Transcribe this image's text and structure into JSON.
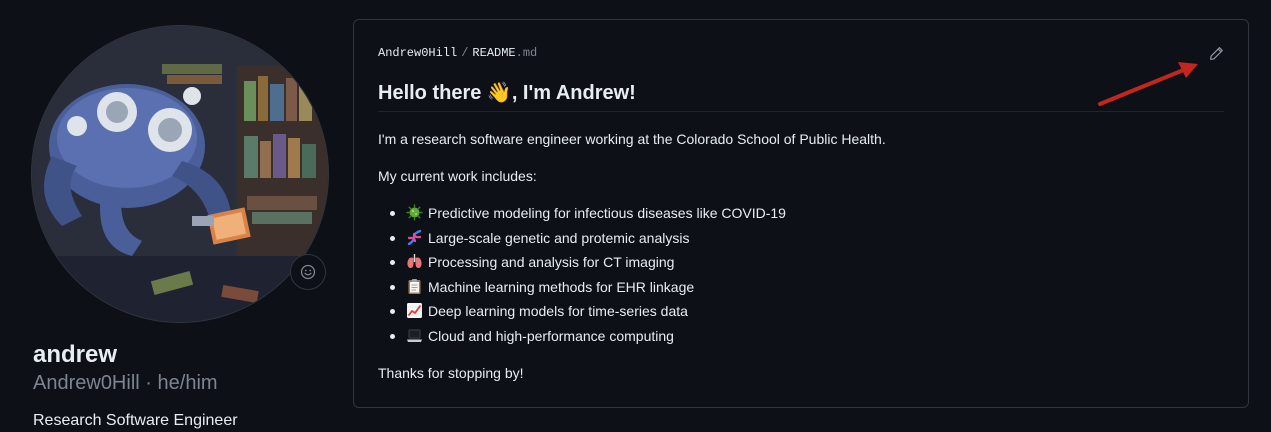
{
  "profile": {
    "name": "andrew",
    "username": "Andrew0Hill",
    "separator": "·",
    "pronouns": "he/him",
    "bio": "Research Software Engineer"
  },
  "readme": {
    "breadcrumb_owner": "Andrew0Hill",
    "breadcrumb_separator": "/",
    "breadcrumb_file": "README",
    "breadcrumb_ext": ".md",
    "title": "Hello there 👋, I'm Andrew!",
    "intro": "I'm a research software engineer working at the Colorado School of Public Health.",
    "work_heading": "My current work includes:",
    "items": [
      {
        "icon": "microbe-icon",
        "label": "Predictive modeling for infectious diseases like COVID-19"
      },
      {
        "icon": "dna-icon",
        "label": "Large-scale genetic and protemic analysis"
      },
      {
        "icon": "lungs-icon",
        "label": "Processing and analysis for CT imaging"
      },
      {
        "icon": "clipboard-icon",
        "label": "Machine learning methods for EHR linkage"
      },
      {
        "icon": "chart-increasing-icon",
        "label": "Deep learning models for time-series data"
      },
      {
        "icon": "laptop-icon",
        "label": "Cloud and high-performance computing"
      }
    ],
    "closing": "Thanks for stopping by!"
  },
  "colors": {
    "background": "#0d1117",
    "border": "#30363d",
    "text": "#e6edf3",
    "muted": "#7d8590",
    "annotation_arrow": "#c4261d"
  },
  "icons": {
    "status": "smiley-icon",
    "edit": "pencil-icon",
    "annotation": "red-arrow"
  }
}
